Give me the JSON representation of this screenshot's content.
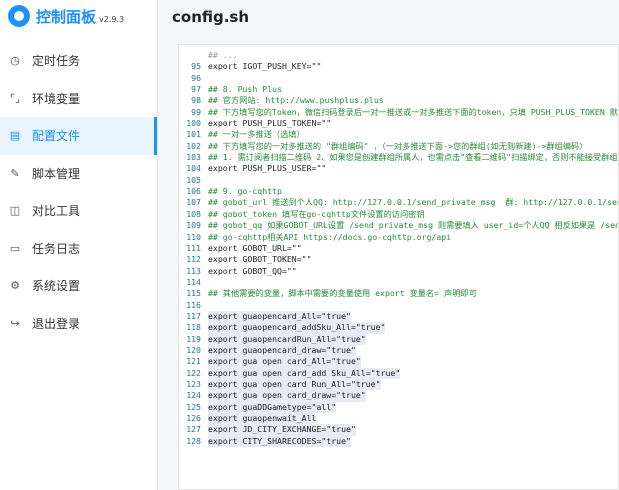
{
  "app": {
    "title": "控制面板",
    "version": "v2.9.3"
  },
  "sidebar": {
    "items": [
      {
        "label": "定时任务",
        "icon": "clock-icon",
        "glyph": "◷"
      },
      {
        "label": "环境变量",
        "icon": "bracket-icon",
        "glyph": "⌜⌟"
      },
      {
        "label": "配置文件",
        "icon": "settings-file-icon",
        "glyph": "▤"
      },
      {
        "label": "脚本管理",
        "icon": "edit-icon",
        "glyph": "✎"
      },
      {
        "label": "对比工具",
        "icon": "diff-icon",
        "glyph": "◫"
      },
      {
        "label": "任务日志",
        "icon": "folder-icon",
        "glyph": "▭"
      },
      {
        "label": "系统设置",
        "icon": "gear-icon",
        "glyph": "⚙"
      },
      {
        "label": "退出登录",
        "icon": "logout-icon",
        "glyph": "↪"
      }
    ],
    "active_index": 2
  },
  "page": {
    "title": "config.sh"
  },
  "editor": {
    "lines": [
      {
        "n": "",
        "t": "## ... ",
        "k": "cut"
      },
      {
        "n": "95",
        "t": "export IGOT_PUSH_KEY=\"\"",
        "k": ""
      },
      {
        "n": "96",
        "t": "",
        "k": ""
      },
      {
        "n": "97",
        "t": "## 8. Push Plus",
        "k": "cmt"
      },
      {
        "n": "98",
        "t": "## 官方网站: http://www.pushplus.plus",
        "k": "cmt"
      },
      {
        "n": "99",
        "t": "## 下方填写您的Token，微信扫码登录后一对一推送或一对多推送下面的token，只填 PUSH_PLUS_TOKEN 默认为一对",
        "k": "cmt"
      },
      {
        "n": "100",
        "t": "export PUSH_PLUS_TOKEN=\"\"",
        "k": ""
      },
      {
        "n": "101",
        "t": "## 一对一多推送（选填）",
        "k": "cmt"
      },
      {
        "n": "102",
        "t": "## 下方填写您的一对多推送的 \"群组编码\" ，（一对多推送下面->您的群组(如无则新建)->群组编码）",
        "k": "cmt"
      },
      {
        "n": "103",
        "t": "## 1. 需订阅者扫描二维码 2、如果您是创建群组所属人，也需点击\"查看二维码\"扫描绑定，否则不能接受群组消息推送",
        "k": "cmt"
      },
      {
        "n": "104",
        "t": "export PUSH_PLUS_USER=\"\"",
        "k": ""
      },
      {
        "n": "105",
        "t": "",
        "k": ""
      },
      {
        "n": "106",
        "t": "## 9. go-cqhttp",
        "k": "cmt"
      },
      {
        "n": "107",
        "t": "## gobot_url 推送到个人QQ: http://127.0.0.1/send_private_msg  群: http://127.0.0.1/send_group_msg",
        "k": "cmt"
      },
      {
        "n": "108",
        "t": "## gobot_token 填写在go-cqhttp文件设置的访问密钥",
        "k": "cmt"
      },
      {
        "n": "109",
        "t": "## gobot_qq 如果GOBOT_URL设置 /send_private_msg 则需要填入 user_id=个人QQ 相反如果是 /send_group_msg",
        "k": "cmt"
      },
      {
        "n": "110",
        "t": "## go-cqhttp相关API https://docs.go-cqhttp.org/api",
        "k": "cmt"
      },
      {
        "n": "111",
        "t": "export GOBOT_URL=\"\"",
        "k": ""
      },
      {
        "n": "112",
        "t": "export GOBOT_TOKEN=\"\"",
        "k": ""
      },
      {
        "n": "113",
        "t": "export GOBOT_QQ=\"\"",
        "k": ""
      },
      {
        "n": "114",
        "t": "",
        "k": ""
      },
      {
        "n": "115",
        "t": "## 其他需要的变量，脚本中需要的变量使用 export 变量名= 声明即可",
        "k": "cmt"
      },
      {
        "n": "116",
        "t": "",
        "k": ""
      },
      {
        "n": "117",
        "t": "export guaopencard_All=\"true\"",
        "k": "hl"
      },
      {
        "n": "118",
        "t": "export guaopencard_addSku_All=\"true\"",
        "k": "hl"
      },
      {
        "n": "119",
        "t": "export guaopencardRun_All=\"true\"",
        "k": "hl"
      },
      {
        "n": "120",
        "t": "export guaopencard_draw=\"true\"",
        "k": "hl"
      },
      {
        "n": "121",
        "t": "export gua open card_All=\"true\"",
        "k": "hl"
      },
      {
        "n": "122",
        "t": "export gua open card_add Sku_All=\"true\"",
        "k": "hl"
      },
      {
        "n": "123",
        "t": "export gua open card Run_All=\"true\"",
        "k": "hl"
      },
      {
        "n": "124",
        "t": "export gua open card_draw=\"true\"",
        "k": "hl"
      },
      {
        "n": "125",
        "t": "export guaDDGametype=\"all\"",
        "k": "hl"
      },
      {
        "n": "126",
        "t": "export guaopenwait_All",
        "k": "hl"
      },
      {
        "n": "127",
        "t": "export JD_CITY_EXCHANGE=\"true\"",
        "k": "hl"
      },
      {
        "n": "128",
        "t": "export CITY_SHARECODES=\"true\"",
        "k": "hl"
      }
    ]
  },
  "colors": {
    "accent": "#1e90ff",
    "line_number": "#237893",
    "comment": "#2a8a3a",
    "highlight": "#e8eaf5"
  }
}
